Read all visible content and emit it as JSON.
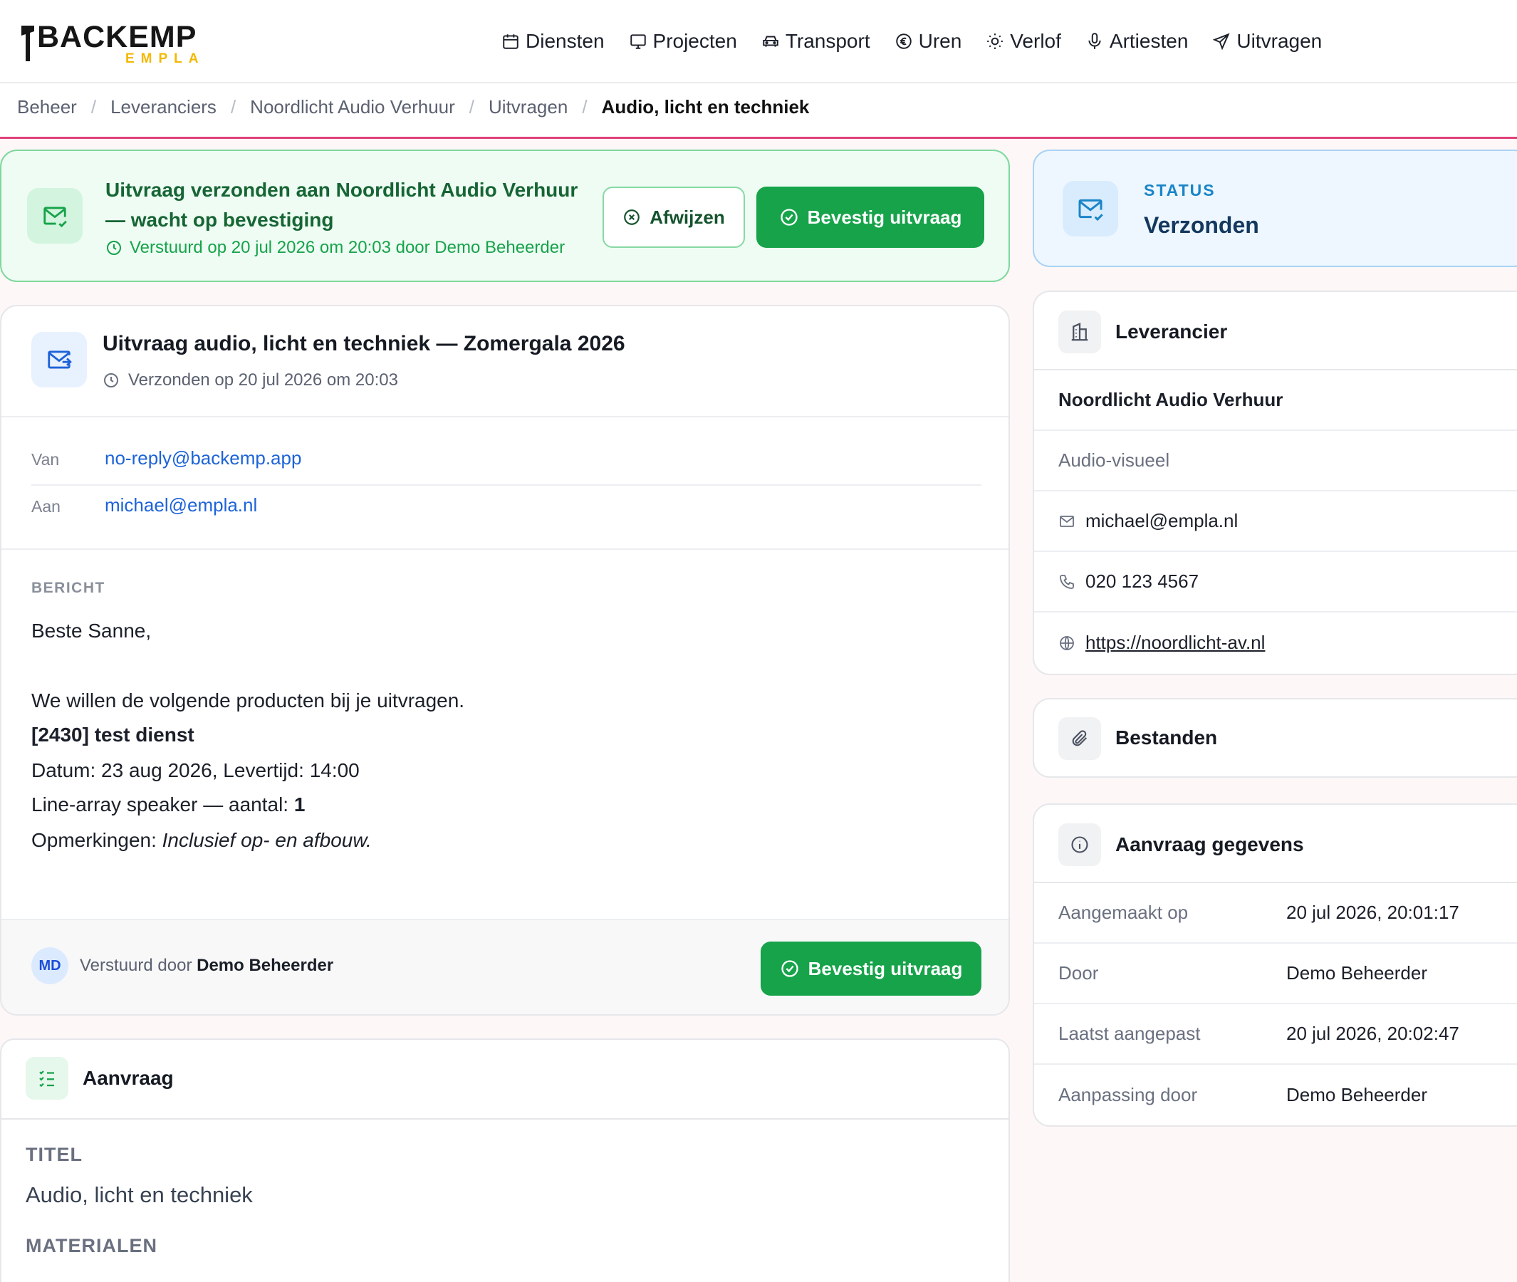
{
  "brand": {
    "name": "BACKEMP",
    "sub": "EMPLA"
  },
  "nav": [
    {
      "label": "Diensten",
      "icon": "calendar-icon"
    },
    {
      "label": "Projecten",
      "icon": "monitor-icon"
    },
    {
      "label": "Transport",
      "icon": "car-icon"
    },
    {
      "label": "Uren",
      "icon": "euro-icon"
    },
    {
      "label": "Verlof",
      "icon": "sun-icon"
    },
    {
      "label": "Artiesten",
      "icon": "microphone-icon"
    },
    {
      "label": "Uitvragen",
      "icon": "send-icon"
    }
  ],
  "breadcrumb": [
    "Beheer",
    "Leveranciers",
    "Noordlicht Audio Verhuur",
    "Uitvragen",
    "Audio, licht en techniek"
  ],
  "banner": {
    "title": "Uitvraag verzonden aan Noordlicht Audio Verhuur — wacht op bevestiging",
    "meta": "Verstuurd op 20 jul 2026 om 20:03 door Demo Beheerder",
    "reject_label": "Afwijzen",
    "confirm_label": "Bevestig uitvraag"
  },
  "status": {
    "label": "STATUS",
    "value": "Verzonden"
  },
  "mail": {
    "title": "Uitvraag audio, licht en techniek — Zomergala 2026",
    "sent": "Verzonden op 20 jul 2026 om 20:03",
    "from_label": "Van",
    "from": "no-reply@backemp.app",
    "to_label": "Aan",
    "to": "michael@empla.nl",
    "body_label": "BERICHT",
    "greeting": "Beste Sanne,",
    "intro": "We willen de volgende producten bij je uitvragen.",
    "item_title": "[2430] test dienst",
    "date_line": "Datum: 23 aug 2026, Levertijd: 14:00",
    "product_prefix": "Line-array speaker — aantal: ",
    "product_qty": "1",
    "remarks_prefix": "Opmerkingen: ",
    "remarks": "Inclusief op- en afbouw.",
    "avatar": "MD",
    "sent_by_prefix": "Verstuurd door ",
    "sent_by": "Demo Beheerder",
    "confirm_label": "Bevestig uitvraag"
  },
  "request": {
    "title": "Aanvraag",
    "title_label": "TITEL",
    "title_value": "Audio, licht en techniek",
    "materials_label": "MATERIALEN"
  },
  "supplier": {
    "header": "Leverancier",
    "name": "Noordlicht Audio Verhuur",
    "category": "Audio-visueel",
    "email": "michael@empla.nl",
    "phone": "020 123 4567",
    "website": "https://noordlicht-av.nl"
  },
  "files": {
    "header": "Bestanden"
  },
  "details": {
    "header": "Aanvraag gegevens",
    "rows": [
      {
        "key": "Aangemaakt op",
        "value": "20 jul 2026, 20:01:17"
      },
      {
        "key": "Door",
        "value": "Demo Beheerder"
      },
      {
        "key": "Laatst aangepast",
        "value": "20 jul 2026, 20:02:47"
      },
      {
        "key": "Aanpassing door",
        "value": "Demo Beheerder"
      }
    ]
  }
}
